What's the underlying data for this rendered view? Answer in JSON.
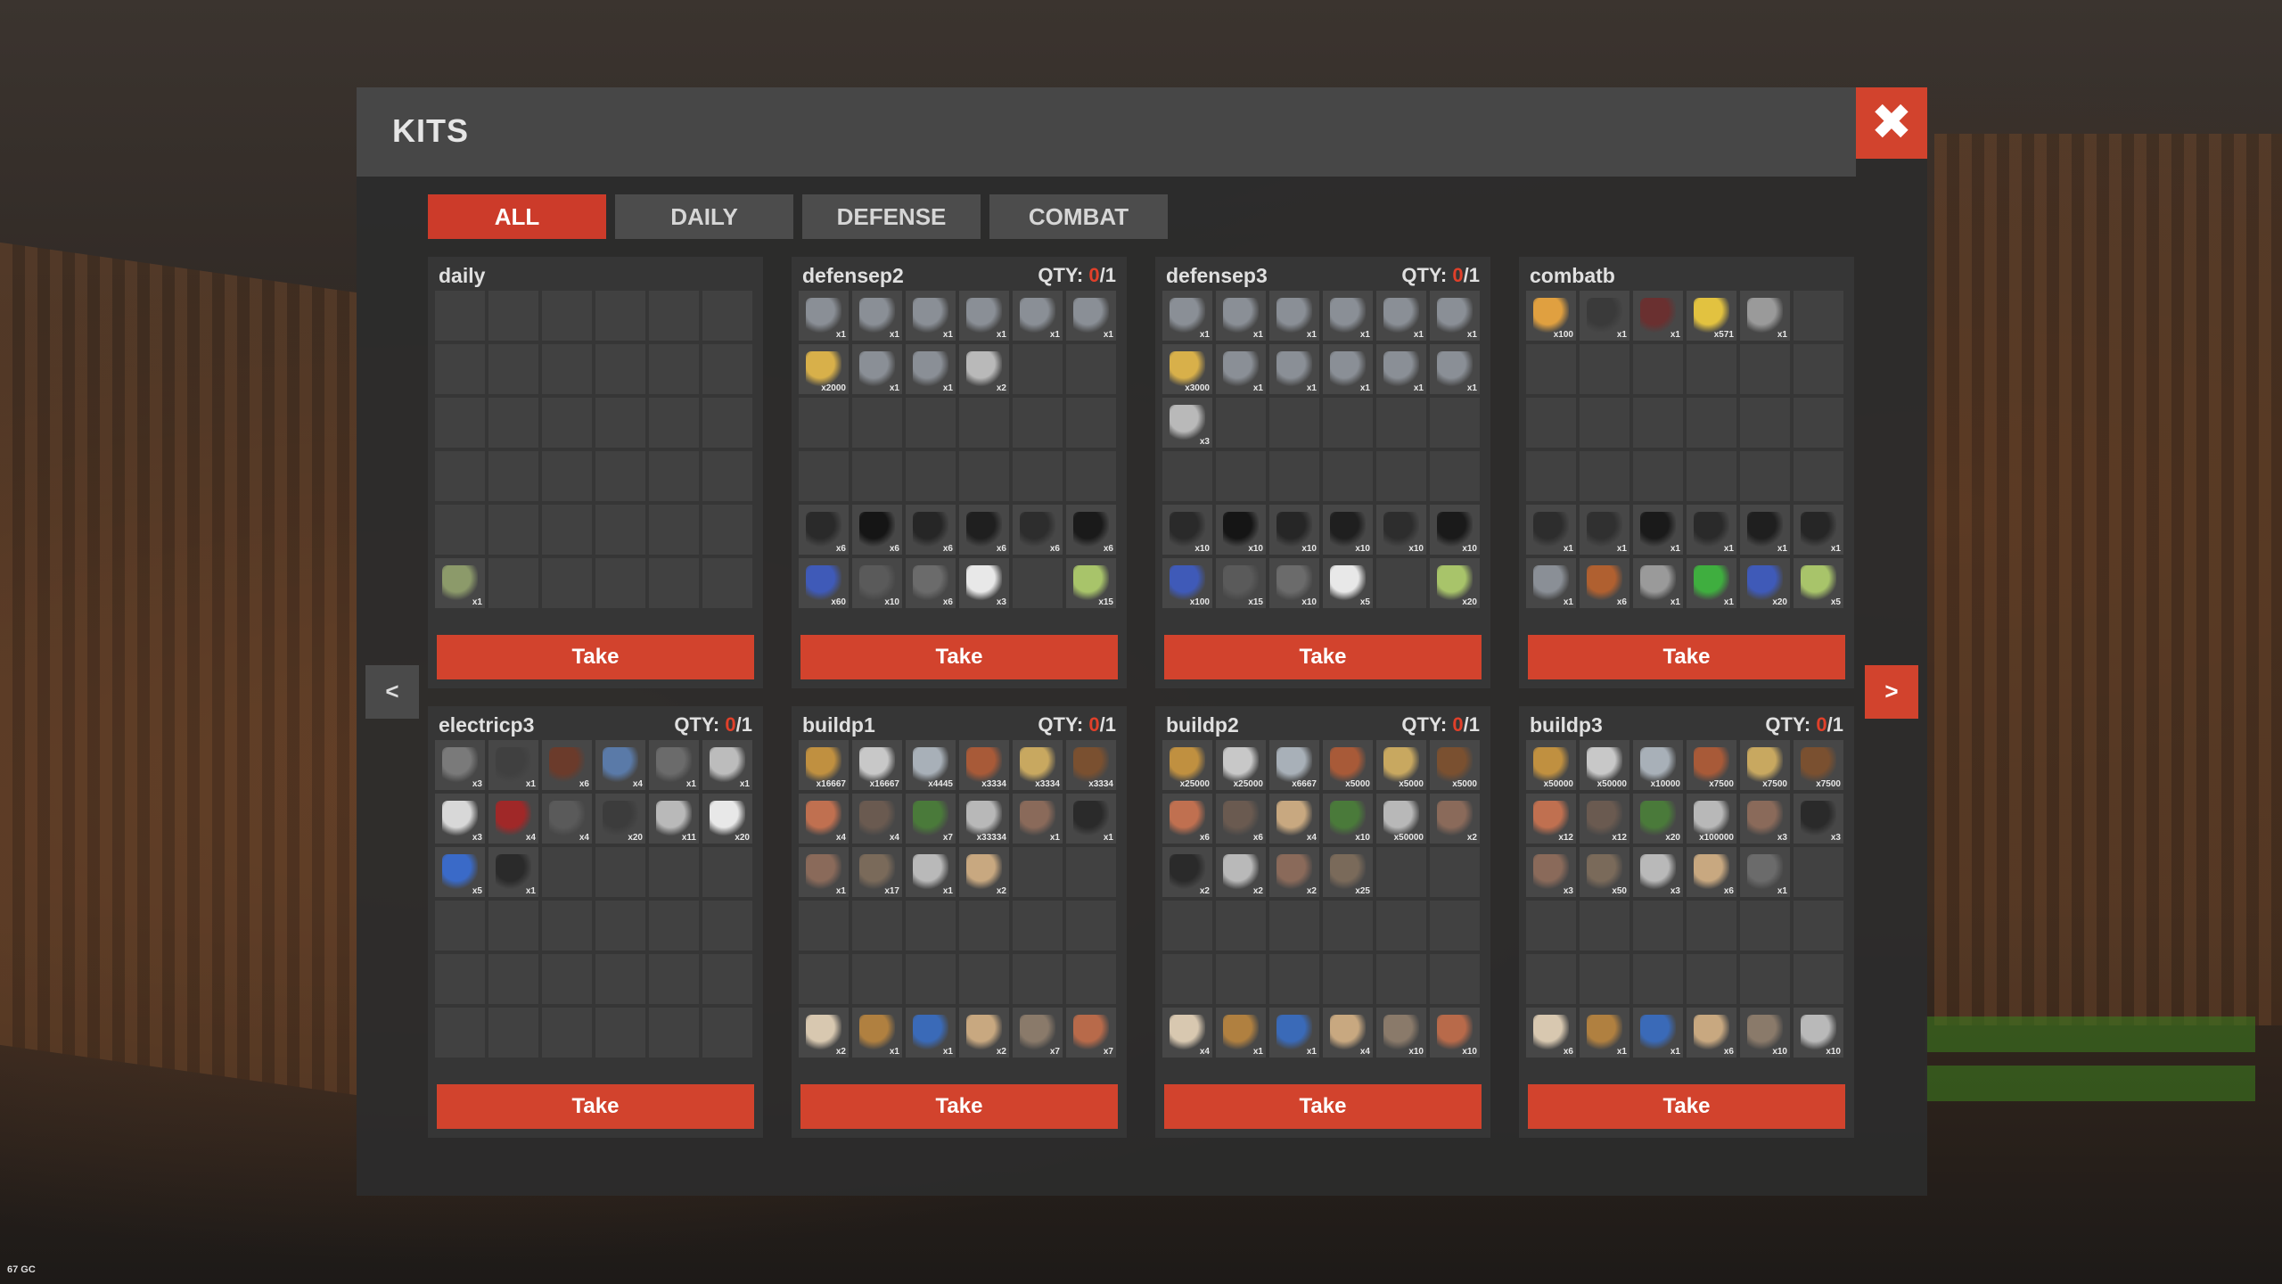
{
  "title": "KITS",
  "close_label": "✖",
  "tabs": [
    {
      "label": "ALL",
      "active": true
    },
    {
      "label": "DAILY",
      "active": false
    },
    {
      "label": "DEFENSE",
      "active": false
    },
    {
      "label": "COMBAT",
      "active": false
    }
  ],
  "nav": {
    "prev": "<",
    "next": ">"
  },
  "take_label": "Take",
  "qty_prefix": "QTY:",
  "corner_text": "67 GC",
  "kits": [
    {
      "name": "daily",
      "qty_used": "",
      "qty_total": "",
      "items": [
        null,
        null,
        null,
        null,
        null,
        null,
        null,
        null,
        null,
        null,
        null,
        null,
        null,
        null,
        null,
        null,
        null,
        null,
        null,
        null,
        null,
        null,
        null,
        null,
        null,
        null,
        null,
        null,
        null,
        null,
        {
          "icon": "launcher-icon",
          "count": "x1"
        },
        null,
        null,
        null,
        null,
        null
      ]
    },
    {
      "name": "defensep2",
      "qty_used": "0",
      "qty_total": "/1",
      "items": [
        {
          "icon": "rifle-icon",
          "count": "x1"
        },
        {
          "icon": "rifle-icon",
          "count": "x1"
        },
        {
          "icon": "rifle-icon",
          "count": "x1"
        },
        {
          "icon": "rifle-icon",
          "count": "x1"
        },
        {
          "icon": "rifle-icon",
          "count": "x1"
        },
        {
          "icon": "rifle-icon",
          "count": "x1"
        },
        {
          "icon": "ammo-icon",
          "count": "x2000"
        },
        {
          "icon": "rifle-icon",
          "count": "x1"
        },
        {
          "icon": "rifle-icon",
          "count": "x1"
        },
        {
          "icon": "door-icon",
          "count": "x2"
        },
        null,
        null,
        null,
        null,
        null,
        null,
        null,
        null,
        null,
        null,
        null,
        null,
        null,
        null,
        {
          "icon": "helmet-icon",
          "count": "x6"
        },
        {
          "icon": "hoodie-icon",
          "count": "x6"
        },
        {
          "icon": "chestplate-icon",
          "count": "x6"
        },
        {
          "icon": "pants-icon",
          "count": "x6"
        },
        {
          "icon": "gloves-icon",
          "count": "x6"
        },
        {
          "icon": "boots-icon",
          "count": "x6"
        },
        {
          "icon": "berries-icon",
          "count": "x60"
        },
        {
          "icon": "trap-icon",
          "count": "x10"
        },
        {
          "icon": "turret-icon",
          "count": "x6"
        },
        {
          "icon": "fuse-icon",
          "count": "x3"
        },
        null,
        {
          "icon": "syringe-icon",
          "count": "x15"
        }
      ]
    },
    {
      "name": "defensep3",
      "qty_used": "0",
      "qty_total": "/1",
      "items": [
        {
          "icon": "rifle-icon",
          "count": "x1"
        },
        {
          "icon": "rifle-icon",
          "count": "x1"
        },
        {
          "icon": "rifle-icon",
          "count": "x1"
        },
        {
          "icon": "rifle-icon",
          "count": "x1"
        },
        {
          "icon": "rifle-icon",
          "count": "x1"
        },
        {
          "icon": "rifle-icon",
          "count": "x1"
        },
        {
          "icon": "ammo-icon",
          "count": "x3000"
        },
        {
          "icon": "rifle-icon",
          "count": "x1"
        },
        {
          "icon": "rifle-icon",
          "count": "x1"
        },
        {
          "icon": "rifle-icon",
          "count": "x1"
        },
        {
          "icon": "rifle-icon",
          "count": "x1"
        },
        {
          "icon": "rifle-icon",
          "count": "x1"
        },
        {
          "icon": "door-icon",
          "count": "x3"
        },
        null,
        null,
        null,
        null,
        null,
        null,
        null,
        null,
        null,
        null,
        null,
        {
          "icon": "helmet-icon",
          "count": "x10"
        },
        {
          "icon": "hoodie-icon",
          "count": "x10"
        },
        {
          "icon": "chestplate-icon",
          "count": "x10"
        },
        {
          "icon": "pants-icon",
          "count": "x10"
        },
        {
          "icon": "gloves-icon",
          "count": "x10"
        },
        {
          "icon": "boots-icon",
          "count": "x10"
        },
        {
          "icon": "berries-icon",
          "count": "x100"
        },
        {
          "icon": "trap-icon",
          "count": "x15"
        },
        {
          "icon": "turret-icon",
          "count": "x10"
        },
        {
          "icon": "fuse-icon",
          "count": "x5"
        },
        null,
        {
          "icon": "syringe-icon",
          "count": "x20"
        }
      ]
    },
    {
      "name": "combatb",
      "qty_used": "",
      "qty_total": "",
      "items": [
        {
          "icon": "potion-icon",
          "count": "x100"
        },
        {
          "icon": "pistol-icon",
          "count": "x1"
        },
        {
          "icon": "smg-icon",
          "count": "x1"
        },
        {
          "icon": "rocket-icon",
          "count": "x571"
        },
        {
          "icon": "knife-icon",
          "count": "x1"
        },
        null,
        null,
        null,
        null,
        null,
        null,
        null,
        null,
        null,
        null,
        null,
        null,
        null,
        null,
        null,
        null,
        null,
        null,
        null,
        {
          "icon": "gloves-icon",
          "count": "x1"
        },
        {
          "icon": "jacket-icon",
          "count": "x1"
        },
        {
          "icon": "boots-icon",
          "count": "x1"
        },
        {
          "icon": "helmet-icon",
          "count": "x1"
        },
        {
          "icon": "pants-icon",
          "count": "x1"
        },
        {
          "icon": "chestplate-icon",
          "count": "x1"
        },
        {
          "icon": "rifle-icon",
          "count": "x1"
        },
        {
          "icon": "grenade-icon",
          "count": "x6"
        },
        {
          "icon": "knife-icon",
          "count": "x1"
        },
        {
          "icon": "medkit-icon",
          "count": "x1"
        },
        {
          "icon": "berries-icon",
          "count": "x20"
        },
        {
          "icon": "syringe-icon",
          "count": "x5"
        }
      ]
    },
    {
      "name": "electricp3",
      "qty_used": "0",
      "qty_total": "/1",
      "items": [
        {
          "icon": "battery-icon",
          "count": "x3"
        },
        {
          "icon": "camera-icon",
          "count": "x1"
        },
        {
          "icon": "hose-icon",
          "count": "x6"
        },
        {
          "icon": "panel-icon",
          "count": "x4"
        },
        {
          "icon": "turret-icon",
          "count": "x1"
        },
        {
          "icon": "lamp-icon",
          "count": "x1"
        },
        {
          "icon": "box-icon",
          "count": "x3"
        },
        {
          "icon": "locker-icon",
          "count": "x4"
        },
        {
          "icon": "switch-icon",
          "count": "x4"
        },
        {
          "icon": "sensor-icon",
          "count": "x20"
        },
        {
          "icon": "door-icon",
          "count": "x11"
        },
        {
          "icon": "light-icon",
          "count": "x20"
        },
        {
          "icon": "reader-icon",
          "count": "x5"
        },
        {
          "icon": "speaker-icon",
          "count": "x1"
        },
        null,
        null,
        null,
        null,
        null,
        null,
        null,
        null,
        null,
        null,
        null,
        null,
        null,
        null,
        null,
        null,
        null,
        null,
        null,
        null,
        null,
        null
      ]
    },
    {
      "name": "buildp1",
      "qty_used": "0",
      "qty_total": "/1",
      "items": [
        {
          "icon": "wood-icon",
          "count": "x16667"
        },
        {
          "icon": "stone-icon",
          "count": "x16667"
        },
        {
          "icon": "metal-icon",
          "count": "x4445"
        },
        {
          "icon": "gear-icon",
          "count": "x3334"
        },
        {
          "icon": "cloth-icon",
          "count": "x3334"
        },
        {
          "icon": "log-icon",
          "count": "x3334"
        },
        {
          "icon": "wall-icon",
          "count": "x4"
        },
        {
          "icon": "fence-icon",
          "count": "x4"
        },
        {
          "icon": "bag-icon",
          "count": "x7"
        },
        {
          "icon": "spike-icon",
          "count": "x33334"
        },
        {
          "icon": "furnace-icon",
          "count": "x1"
        },
        {
          "icon": "pump-icon",
          "count": "x1"
        },
        {
          "icon": "furnace-icon",
          "count": "x1"
        },
        {
          "icon": "crate-icon",
          "count": "x17"
        },
        {
          "icon": "door-icon",
          "count": "x1"
        },
        {
          "icon": "plank-icon",
          "count": "x2"
        },
        null,
        null,
        null,
        null,
        null,
        null,
        null,
        null,
        null,
        null,
        null,
        null,
        null,
        null,
        {
          "icon": "plane-icon",
          "count": "x2"
        },
        {
          "icon": "hammer-icon",
          "count": "x1"
        },
        {
          "icon": "blueprint-icon",
          "count": "x1"
        },
        {
          "icon": "plank-icon",
          "count": "x2"
        },
        {
          "icon": "cabinet-icon",
          "count": "x7"
        },
        {
          "icon": "brick-icon",
          "count": "x7"
        }
      ]
    },
    {
      "name": "buildp2",
      "qty_used": "0",
      "qty_total": "/1",
      "items": [
        {
          "icon": "wood-icon",
          "count": "x25000"
        },
        {
          "icon": "stone-icon",
          "count": "x25000"
        },
        {
          "icon": "metal-icon",
          "count": "x6667"
        },
        {
          "icon": "gear-icon",
          "count": "x5000"
        },
        {
          "icon": "cloth-icon",
          "count": "x5000"
        },
        {
          "icon": "log-icon",
          "count": "x5000"
        },
        {
          "icon": "wall-icon",
          "count": "x6"
        },
        {
          "icon": "fence-icon",
          "count": "x6"
        },
        {
          "icon": "plank-icon",
          "count": "x4"
        },
        {
          "icon": "bag-icon",
          "count": "x10"
        },
        {
          "icon": "spike-icon",
          "count": "x50000"
        },
        {
          "icon": "furnace-icon",
          "count": "x2"
        },
        {
          "icon": "pump-icon",
          "count": "x2"
        },
        {
          "icon": "door-icon",
          "count": "x2"
        },
        {
          "icon": "furnace-icon",
          "count": "x2"
        },
        {
          "icon": "crate-icon",
          "count": "x25"
        },
        null,
        null,
        null,
        null,
        null,
        null,
        null,
        null,
        null,
        null,
        null,
        null,
        null,
        null,
        {
          "icon": "plane-icon",
          "count": "x4"
        },
        {
          "icon": "hammer-icon",
          "count": "x1"
        },
        {
          "icon": "blueprint-icon",
          "count": "x1"
        },
        {
          "icon": "plank-icon",
          "count": "x4"
        },
        {
          "icon": "cabinet-icon",
          "count": "x10"
        },
        {
          "icon": "brick-icon",
          "count": "x10"
        }
      ]
    },
    {
      "name": "buildp3",
      "qty_used": "0",
      "qty_total": "/1",
      "items": [
        {
          "icon": "wood-icon",
          "count": "x50000"
        },
        {
          "icon": "stone-icon",
          "count": "x50000"
        },
        {
          "icon": "metal-icon",
          "count": "x10000"
        },
        {
          "icon": "gear-icon",
          "count": "x7500"
        },
        {
          "icon": "cloth-icon",
          "count": "x7500"
        },
        {
          "icon": "log-icon",
          "count": "x7500"
        },
        {
          "icon": "wall-icon",
          "count": "x12"
        },
        {
          "icon": "fence-icon",
          "count": "x12"
        },
        {
          "icon": "bag-icon",
          "count": "x20"
        },
        {
          "icon": "spike-icon",
          "count": "x100000"
        },
        {
          "icon": "furnace-icon",
          "count": "x3"
        },
        {
          "icon": "pump-icon",
          "count": "x3"
        },
        {
          "icon": "furnace-icon",
          "count": "x3"
        },
        {
          "icon": "crate-icon",
          "count": "x50"
        },
        {
          "icon": "door-icon",
          "count": "x3"
        },
        {
          "icon": "plank-icon",
          "count": "x6"
        },
        {
          "icon": "turret-icon",
          "count": "x1"
        },
        null,
        null,
        null,
        null,
        null,
        null,
        null,
        null,
        null,
        null,
        null,
        null,
        null,
        {
          "icon": "plane-icon",
          "count": "x6"
        },
        {
          "icon": "hammer-icon",
          "count": "x1"
        },
        {
          "icon": "blueprint-icon",
          "count": "x1"
        },
        {
          "icon": "plank-icon",
          "count": "x6"
        },
        {
          "icon": "cabinet-icon",
          "count": "x10"
        },
        {
          "icon": "door-icon",
          "count": "x10"
        }
      ]
    }
  ],
  "icon_colors": {
    "rifle-icon": "#8a8f96",
    "ammo-icon": "#d8b04a",
    "door-icon": "#b9b9b9",
    "helmet-icon": "#2a2a2a",
    "hoodie-icon": "#151515",
    "chestplate-icon": "#262626",
    "pants-icon": "#1f1f1f",
    "gloves-icon": "#2d2d2d",
    "boots-icon": "#1a1a1a",
    "berries-icon": "#3f5ab8",
    "trap-icon": "#5a5a5a",
    "turret-icon": "#6b6b6b",
    "fuse-icon": "#e8e8e8",
    "syringe-icon": "#a8c46a",
    "potion-icon": "#e0a040",
    "pistol-icon": "#3a3a3a",
    "smg-icon": "#6a3030",
    "rocket-icon": "#e2c240",
    "knife-icon": "#9a9a9a",
    "jacket-icon": "#303030",
    "grenade-icon": "#b06030",
    "medkit-icon": "#3fae3f",
    "launcher-icon": "#8c9a6a",
    "battery-icon": "#7a7a7a",
    "camera-icon": "#404040",
    "hose-icon": "#6b3b2b",
    "panel-icon": "#5a7aa8",
    "lamp-icon": "#bcbcbc",
    "box-icon": "#d8d8d8",
    "locker-icon": "#a02828",
    "switch-icon": "#5a5a5a",
    "sensor-icon": "#3c3c3c",
    "light-icon": "#e8e8e8",
    "reader-icon": "#3a6ac8",
    "speaker-icon": "#2a2a2a",
    "wood-icon": "#c09040",
    "stone-icon": "#c8c8c8",
    "metal-icon": "#a8b0b8",
    "gear-icon": "#a85a38",
    "cloth-icon": "#c8a860",
    "log-icon": "#7a5030",
    "wall-icon": "#c07050",
    "fence-icon": "#6a5a50",
    "bag-icon": "#4a7a3a",
    "spike-icon": "#b8b8b8",
    "furnace-icon": "#8a6a5a",
    "pump-icon": "#2a2a2a",
    "crate-icon": "#7a6a5a",
    "plank-icon": "#c8a880",
    "plane-icon": "#d8c8b0",
    "hammer-icon": "#b08040",
    "blueprint-icon": "#3a6ab8",
    "cabinet-icon": "#8a7a6a",
    "brick-icon": "#b86a4a"
  }
}
